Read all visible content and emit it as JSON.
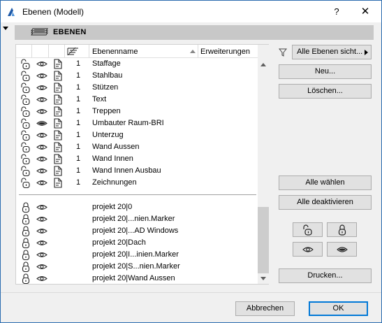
{
  "window": {
    "title": "Ebenen (Modell)",
    "help": "?",
    "close": "✕"
  },
  "section": {
    "title": "EBENEN"
  },
  "columns": {
    "name": "Ebenenname",
    "extensions": "Erweiterungen"
  },
  "layers": [
    {
      "num": "1",
      "name": "Staffage",
      "visible": true
    },
    {
      "num": "1",
      "name": "Stahlbau",
      "visible": true
    },
    {
      "num": "1",
      "name": "Stützen",
      "visible": true
    },
    {
      "num": "1",
      "name": "Text",
      "visible": true
    },
    {
      "num": "1",
      "name": "Treppen",
      "visible": true
    },
    {
      "num": "1",
      "name": "Umbauter Raum-BRI",
      "visible": false
    },
    {
      "num": "1",
      "name": "Unterzug",
      "visible": true
    },
    {
      "num": "1",
      "name": "Wand Aussen",
      "visible": true
    },
    {
      "num": "1",
      "name": "Wand Innen",
      "visible": true
    },
    {
      "num": "1",
      "name": "Wand Innen Ausbau",
      "visible": true
    },
    {
      "num": "1",
      "name": "Zeichnungen",
      "visible": true
    }
  ],
  "xrefs": [
    {
      "name": "projekt 20|0"
    },
    {
      "name": "projekt 20|...nien.Marker"
    },
    {
      "name": "projekt 20|...AD Windows"
    },
    {
      "name": "projekt 20|Dach"
    },
    {
      "name": "projekt 20|I...inien.Marker"
    },
    {
      "name": "projekt 20|S...nien.Marker"
    },
    {
      "name": "projekt 20|Wand Aussen"
    }
  ],
  "buttons": {
    "filter_dropdown": "Alle Ebenen sicht...",
    "new": "Neu...",
    "delete": "Löschen...",
    "select_all": "Alle wählen",
    "deactivate_all": "Alle deaktivieren",
    "print": "Drucken...",
    "cancel": "Abbrechen",
    "ok": "OK"
  }
}
